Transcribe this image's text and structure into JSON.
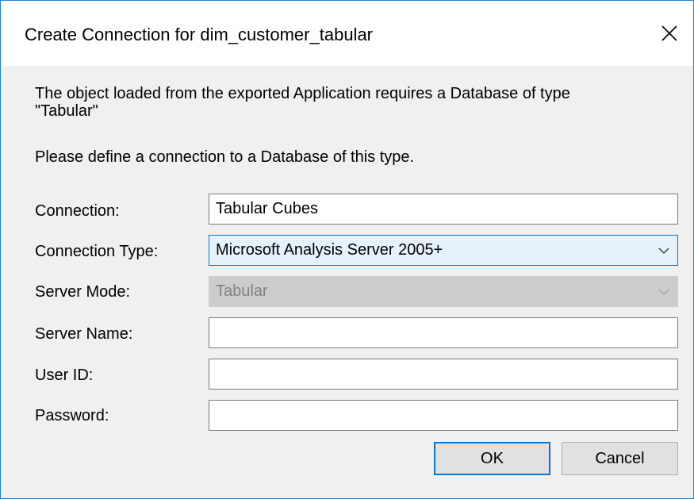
{
  "dialog": {
    "title": "Create Connection for dim_customer_tabular",
    "message": "The object loaded from the exported Application requires a Database of type \"Tabular\"",
    "instruction": "Please define a connection to a Database of this type."
  },
  "form": {
    "connection": {
      "label": "Connection:",
      "value": "Tabular Cubes"
    },
    "connection_type": {
      "label": "Connection Type:",
      "value": "Microsoft Analysis Server 2005+"
    },
    "server_mode": {
      "label": "Server Mode:",
      "value": "Tabular"
    },
    "server_name": {
      "label": "Server Name:",
      "value": ""
    },
    "user_id": {
      "label": "User ID:",
      "value": ""
    },
    "password": {
      "label": "Password:",
      "value": ""
    }
  },
  "buttons": {
    "ok": "OK",
    "cancel": "Cancel"
  },
  "icons": {
    "close": "close-icon",
    "dropdown": "chevron-down-icon"
  },
  "colors": {
    "accent": "#0078d7",
    "window_border": "#1883d7",
    "disabled": "#cccccc"
  }
}
